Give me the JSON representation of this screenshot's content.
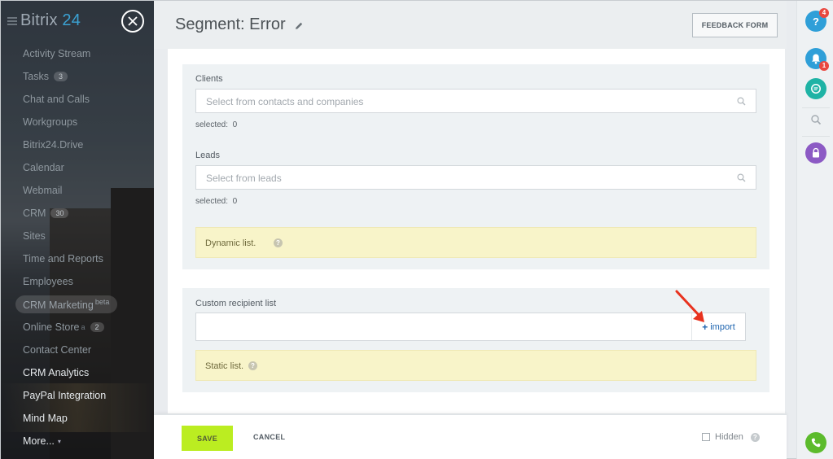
{
  "sidebar": {
    "logo_prefix": "Bitrix",
    "logo_suffix": "24",
    "items": [
      {
        "label": "Activity Stream"
      },
      {
        "label": "Tasks",
        "counter": "3"
      },
      {
        "label": "Chat and Calls"
      },
      {
        "label": "Workgroups"
      },
      {
        "label": "Bitrix24.Drive"
      },
      {
        "label": "Calendar"
      },
      {
        "label": "Webmail"
      },
      {
        "label": "CRM",
        "counter": "30"
      },
      {
        "label": "Sites"
      },
      {
        "label": "Time and Reports"
      },
      {
        "label": "Employees"
      },
      {
        "label": "CRM Marketing",
        "sup": "beta"
      },
      {
        "label": "Online Store",
        "sup": "a",
        "counter": "2"
      },
      {
        "label": "Contact Center"
      },
      {
        "label": "CRM Analytics"
      },
      {
        "label": "PayPal Integration"
      },
      {
        "label": "Mind Map"
      },
      {
        "label": "More..."
      }
    ]
  },
  "header": {
    "title": "Segment: Error",
    "feedback_label": "FEEDBACK FORM"
  },
  "form": {
    "clients_label": "Clients",
    "clients_placeholder": "Select from contacts and companies",
    "clients_selected_label": "selected:",
    "clients_selected_count": "0",
    "leads_label": "Leads",
    "leads_placeholder": "Select from leads",
    "leads_selected_label": "selected:",
    "leads_selected_count": "0",
    "dynamic_note": "Dynamic list.",
    "custom_label": "Custom recipient list",
    "import_label": "import",
    "static_note": "Static list."
  },
  "footer": {
    "save_label": "SAVE",
    "cancel_label": "CANCEL",
    "hidden_label": "Hidden"
  },
  "rightbar": {
    "help_badge": "4",
    "notifications_badge": "1"
  },
  "colors": {
    "save_button": "#bbed21",
    "note_background": "#f8f4c9",
    "link": "#2066b0",
    "arrow": "#e8321e"
  }
}
